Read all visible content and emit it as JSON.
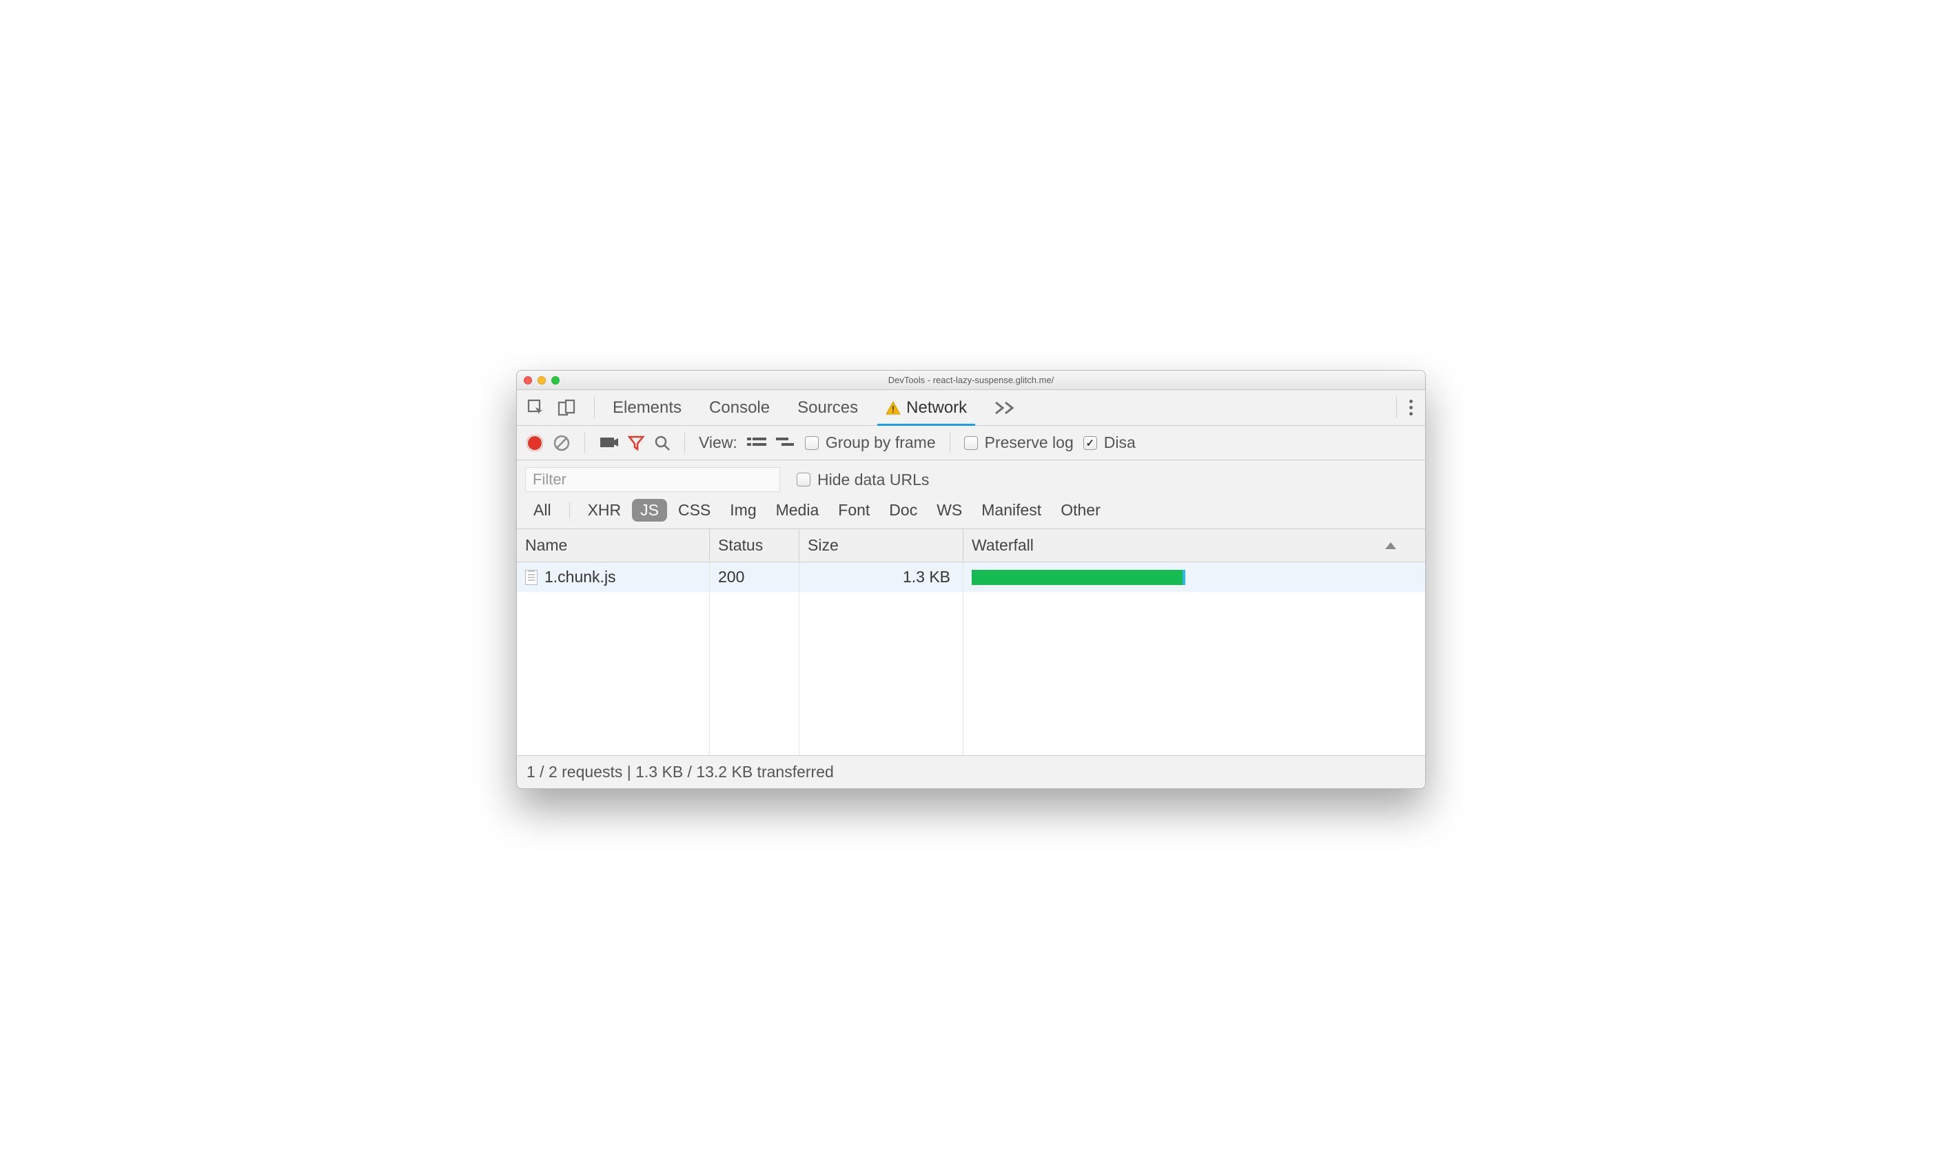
{
  "window": {
    "title": "DevTools - react-lazy-suspense.glitch.me/"
  },
  "tabs": {
    "items": [
      "Elements",
      "Console",
      "Sources",
      "Network"
    ],
    "active": "Network",
    "has_warning": true
  },
  "toolbar": {
    "view_label": "View:",
    "group_by_frame_label": "Group by frame",
    "group_by_frame_checked": false,
    "preserve_log_label": "Preserve log",
    "preserve_log_checked": false,
    "disable_cache_label_truncated": "Disa",
    "disable_cache_checked": true
  },
  "filter": {
    "placeholder": "Filter",
    "hide_data_urls_label": "Hide data URLs",
    "hide_data_urls_checked": false,
    "types": [
      "All",
      "XHR",
      "JS",
      "CSS",
      "Img",
      "Media",
      "Font",
      "Doc",
      "WS",
      "Manifest",
      "Other"
    ],
    "active_type": "JS"
  },
  "table": {
    "columns": {
      "name": "Name",
      "status": "Status",
      "size": "Size",
      "waterfall": "Waterfall"
    },
    "rows": [
      {
        "name": "1.chunk.js",
        "status": "200",
        "size": "1.3 KB",
        "waterfall_pct": 48
      }
    ]
  },
  "status": {
    "summary": "1 / 2 requests | 1.3 KB / 13.2 KB transferred"
  }
}
